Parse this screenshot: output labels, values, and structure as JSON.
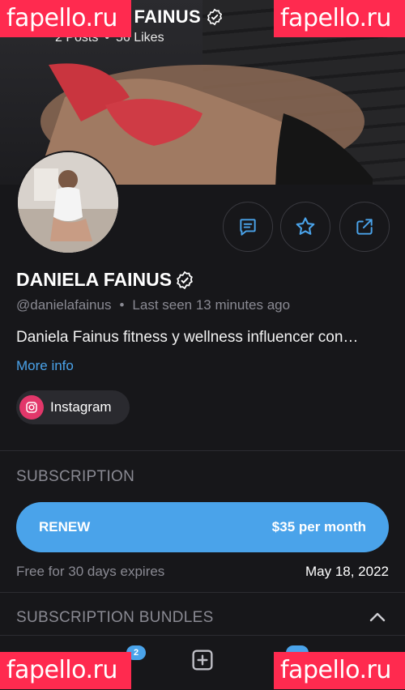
{
  "cover": {
    "title": "DANIELA FAINUS",
    "posts_count": "2 Posts",
    "likes_count": "56 Likes",
    "separator": "•"
  },
  "watermarks": {
    "text": "fapello.ru"
  },
  "profile": {
    "name": "DANIELA FAINUS",
    "handle": "@danielafainus",
    "separator": "•",
    "last_seen": "Last seen 13 minutes ago",
    "bio": "Daniela Fainus fitness y wellness influencer con…",
    "more_info": "More info",
    "social": {
      "label": "Instagram",
      "icon": "instagram-icon",
      "color": "#e2376a"
    }
  },
  "actions": {
    "message_icon": "message-icon",
    "favorite_icon": "star-icon",
    "share_icon": "share-icon"
  },
  "subscription": {
    "section_title": "SUBSCRIPTION",
    "renew_label": "RENEW",
    "price": "$35 per month",
    "note": "Free for 30 days expires",
    "expiry_date": "May 18, 2022"
  },
  "bundles": {
    "section_title": "SUBSCRIPTION BUNDLES"
  },
  "bottom_nav": {
    "left_badge": "2",
    "add_icon": "add-post-icon"
  },
  "colors": {
    "accent": "#4aa3ea",
    "background": "#17171a",
    "watermark": "#ff2a4f",
    "muted_text": "#8a8a93"
  }
}
